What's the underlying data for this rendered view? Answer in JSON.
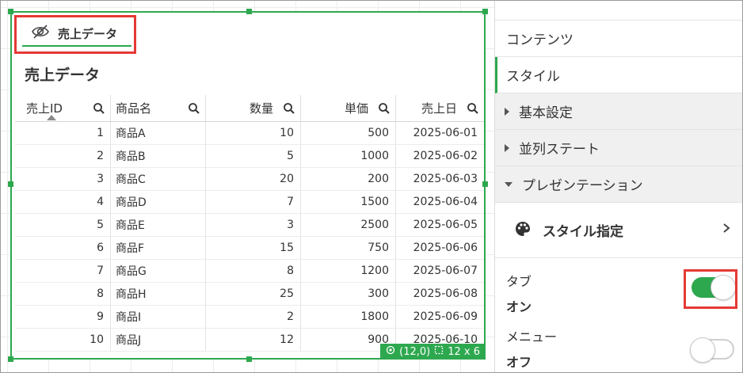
{
  "object": {
    "tab_label": "売上データ",
    "title": "売上データ",
    "status": {
      "coords": "(12,0)",
      "size": "12 x 6"
    }
  },
  "table": {
    "columns": [
      "売上ID",
      "商品名",
      "数量",
      "単価",
      "売上日"
    ],
    "rows": [
      [
        "1",
        "商品A",
        "10",
        "500",
        "2025-06-01"
      ],
      [
        "2",
        "商品B",
        "5",
        "1000",
        "2025-06-02"
      ],
      [
        "3",
        "商品C",
        "20",
        "200",
        "2025-06-03"
      ],
      [
        "4",
        "商品D",
        "7",
        "1500",
        "2025-06-04"
      ],
      [
        "5",
        "商品E",
        "3",
        "2500",
        "2025-06-05"
      ],
      [
        "6",
        "商品F",
        "15",
        "750",
        "2025-06-06"
      ],
      [
        "7",
        "商品G",
        "8",
        "1200",
        "2025-06-07"
      ],
      [
        "8",
        "商品H",
        "25",
        "300",
        "2025-06-08"
      ],
      [
        "9",
        "商品I",
        "2",
        "1800",
        "2025-06-09"
      ],
      [
        "10",
        "商品J",
        "12",
        "900",
        "2025-06-10"
      ]
    ]
  },
  "panel": {
    "tabs": [
      "コンテンツ",
      "スタイル"
    ],
    "sections": [
      "基本設定",
      "並列ステート",
      "プレゼンテーション"
    ],
    "style_spec_label": "スタイル指定",
    "props": [
      {
        "label": "タブ",
        "value": "オン",
        "on": true
      },
      {
        "label": "メニュー",
        "value": "オフ",
        "on": false
      }
    ]
  },
  "colors": {
    "accent": "#2ea84f",
    "highlight": "#e53935"
  }
}
